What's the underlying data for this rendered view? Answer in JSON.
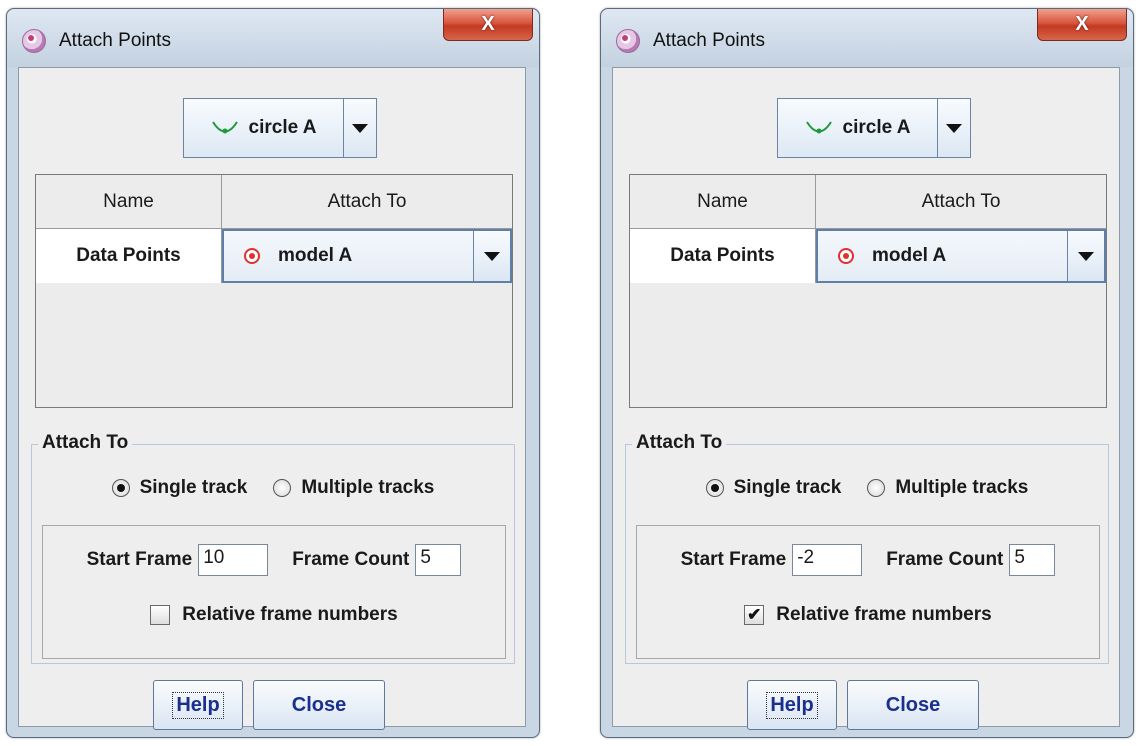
{
  "windows": [
    {
      "title": "Attach Points",
      "close_glyph": "X",
      "track_select": {
        "icon": "circle-track-icon",
        "value": "circle A"
      },
      "table": {
        "headers": [
          "Name",
          "Attach To"
        ],
        "rows": [
          {
            "name": "Data Points",
            "attach_to": "model A",
            "attach_icon": "target-icon"
          }
        ]
      },
      "attach_group": {
        "legend": "Attach To",
        "single_label": "Single track",
        "multiple_label": "Multiple tracks",
        "selected": "single",
        "start_frame_label": "Start Frame",
        "start_frame": "10",
        "frame_count_label": "Frame Count",
        "frame_count": "5",
        "relative_label": "Relative frame numbers",
        "relative_checked": false,
        "check_glyph": ""
      },
      "buttons": {
        "help": "Help",
        "close": "Close"
      }
    },
    {
      "title": "Attach Points",
      "close_glyph": "X",
      "track_select": {
        "icon": "circle-track-icon",
        "value": "circle A"
      },
      "table": {
        "headers": [
          "Name",
          "Attach To"
        ],
        "rows": [
          {
            "name": "Data Points",
            "attach_to": "model A",
            "attach_icon": "target-icon"
          }
        ]
      },
      "attach_group": {
        "legend": "Attach To",
        "single_label": "Single track",
        "multiple_label": "Multiple tracks",
        "selected": "single",
        "start_frame_label": "Start Frame",
        "start_frame": "-2",
        "frame_count_label": "Frame Count",
        "frame_count": "5",
        "relative_label": "Relative frame numbers",
        "relative_checked": true,
        "check_glyph": "✔"
      },
      "buttons": {
        "help": "Help",
        "close": "Close"
      }
    }
  ]
}
